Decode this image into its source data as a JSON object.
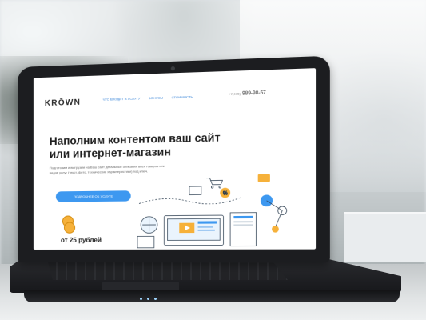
{
  "site": {
    "logo": "KRŌWN",
    "nav": [
      {
        "label": "Что входит в услугу"
      },
      {
        "label": "Бонусы"
      },
      {
        "label": "Стоимость"
      }
    ],
    "phone_code": "+7(495)",
    "phone_number": "989-98-57",
    "hero_title": "Наполним контентом ваш сайт или интернет-магазин",
    "hero_text": "Подготовим и выгрузим на Ваш сайт детальные описания всех товаров или видов услуг (текст, фото, технические характеристики) под ключ.",
    "cta_label": "Подробнее об услуге",
    "price": "от 25 рублей"
  },
  "colors": {
    "accent": "#3d98f0",
    "laptop": "#1c1d20",
    "coin": "#f6b13a"
  }
}
